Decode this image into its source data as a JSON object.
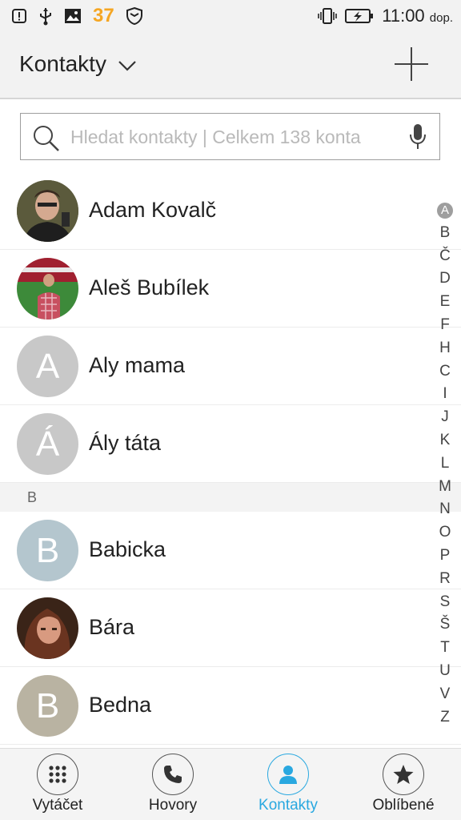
{
  "status_bar": {
    "notification_count": "37",
    "time": "11:00",
    "time_suffix": "dop."
  },
  "header": {
    "title": "Kontakty",
    "dropdown_icon": "chevron-down-icon",
    "add_icon": "plus-icon"
  },
  "search": {
    "placeholder": "Hledat kontakty | Celkem 138 konta",
    "value": ""
  },
  "contacts": [
    {
      "name": "Adam Kovalč",
      "initial": "",
      "avatar": "photo"
    },
    {
      "name": "Aleš Bubílek",
      "initial": "",
      "avatar": "photo"
    },
    {
      "name": "Aly mama",
      "initial": "A",
      "avatar_color": "#c8c8c8"
    },
    {
      "name": "Ály táta",
      "initial": "Á",
      "avatar_color": "#c8c8c8"
    },
    {
      "name": "Babicka",
      "initial": "B",
      "avatar_color": "#b4c6ce"
    },
    {
      "name": "Bára",
      "initial": "",
      "avatar": "photo"
    },
    {
      "name": "Bedna",
      "initial": "B",
      "avatar_color": "#b9b3a2"
    }
  ],
  "sections": [
    {
      "letter": "B"
    }
  ],
  "alphabet_index": [
    "A",
    "B",
    "Č",
    "D",
    "E",
    "F",
    "H",
    "C",
    "I",
    "J",
    "K",
    "L",
    "M",
    "N",
    "O",
    "P",
    "R",
    "S",
    "Š",
    "T",
    "U",
    "V",
    "Z"
  ],
  "alphabet_active": "A",
  "bottom_nav": [
    {
      "label": "Vytáčet",
      "icon": "dialpad-icon"
    },
    {
      "label": "Hovory",
      "icon": "phone-icon"
    },
    {
      "label": "Kontakty",
      "icon": "person-icon",
      "active": true
    },
    {
      "label": "Oblíbené",
      "icon": "star-icon"
    }
  ],
  "colors": {
    "accent": "#29a8e0",
    "status_number": "#f5a623"
  }
}
